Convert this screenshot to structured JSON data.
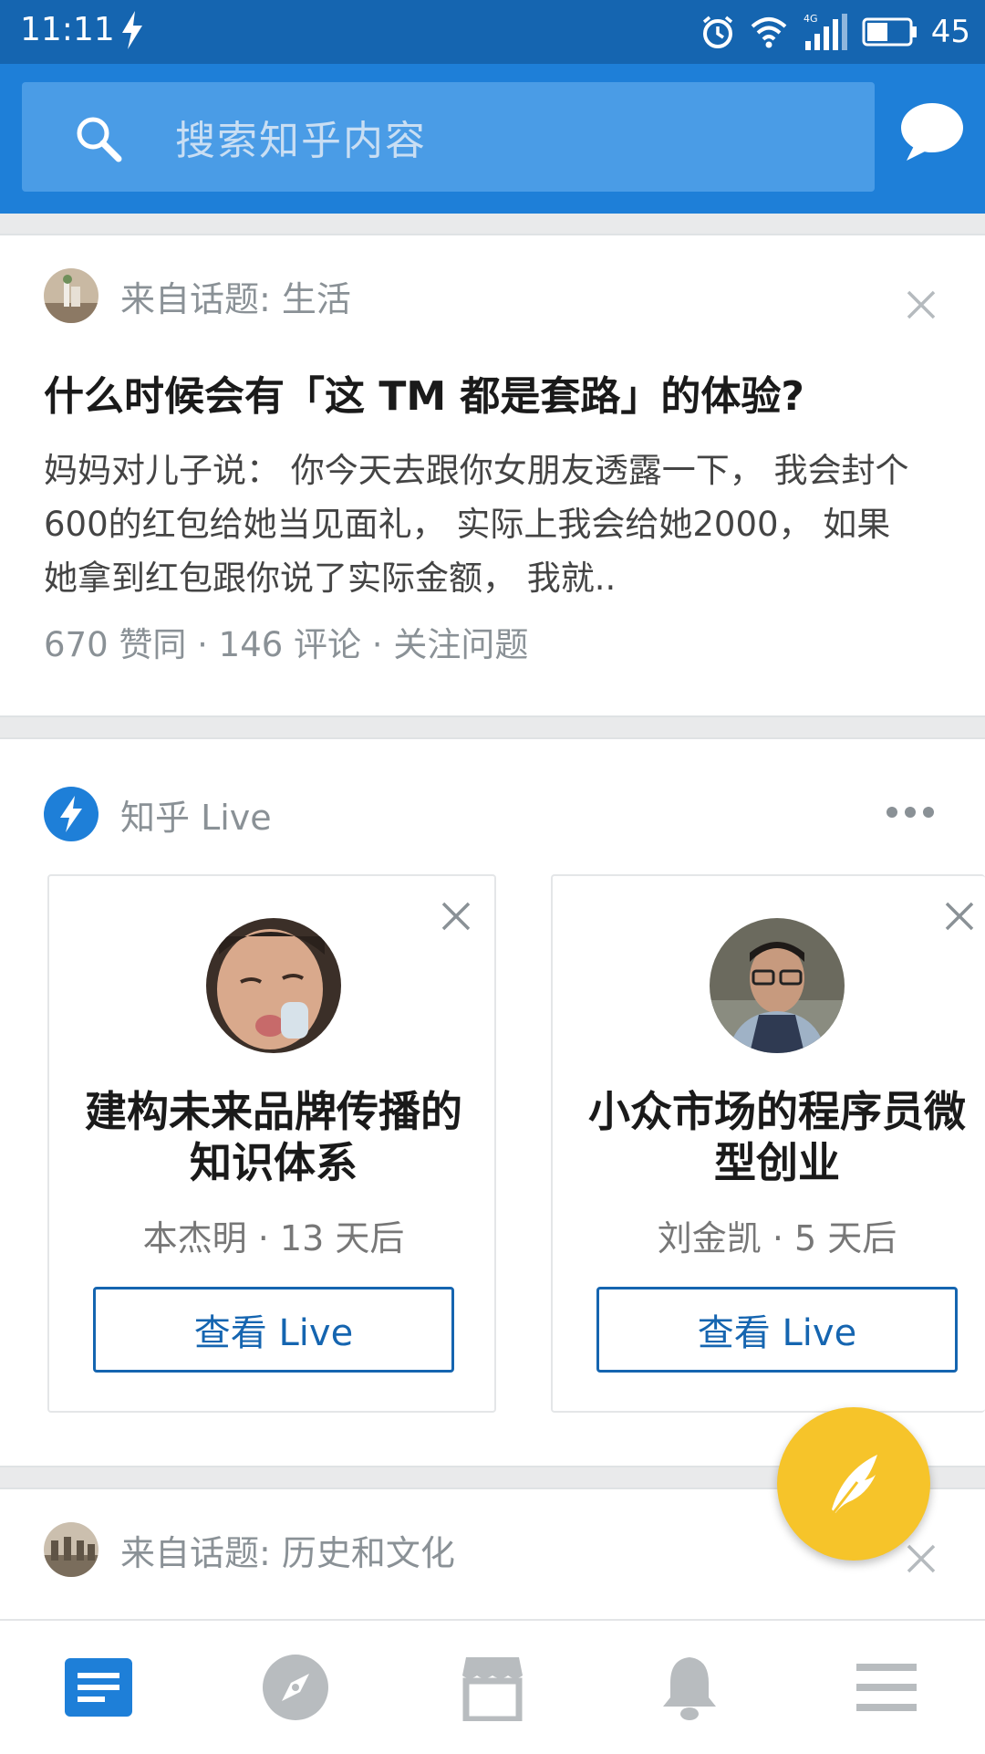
{
  "status_bar": {
    "time": "11:11",
    "network": "4G",
    "battery": "45"
  },
  "search": {
    "placeholder": "搜索知乎内容"
  },
  "feed": {
    "question_card": {
      "topic": "来自话题: 生活",
      "title": "什么时候会有「这 TM 都是套路」的体验?",
      "excerpt": "妈妈对儿子说： 你今天去跟你女朋友透露一下， 我会封个600的红包给她当见面礼， 实际上我会给她2000， 如果她拿到红包跟你说了实际金额， 我就..",
      "meta": "670 赞同 · 146 评论 · 关注问题"
    },
    "live_section": {
      "title": "知乎 Live",
      "cards": [
        {
          "title": "建构未来品牌传播的知识体系",
          "subtitle": "本杰明 · 13 天后",
          "button": "查看 Live"
        },
        {
          "title": "小众市场的程序员微型创业",
          "subtitle": "刘金凯 · 5 天后",
          "button": "查看 Live"
        }
      ]
    },
    "next_card": {
      "topic": "来自话题: 历史和文化"
    }
  },
  "bottom_nav": [
    {
      "icon": "feed-icon",
      "active": true
    },
    {
      "icon": "compass-icon",
      "active": false
    },
    {
      "icon": "store-icon",
      "active": false
    },
    {
      "icon": "bell-icon",
      "active": false
    },
    {
      "icon": "menu-icon",
      "active": false
    }
  ],
  "colors": {
    "status_bar": "#1565b0",
    "app_bar": "#1e7fd8",
    "search_box": "#4a9ce6",
    "accent": "#1e7fd8",
    "fab": "#f6c42a",
    "nav_inactive": "#b8bcbf"
  }
}
